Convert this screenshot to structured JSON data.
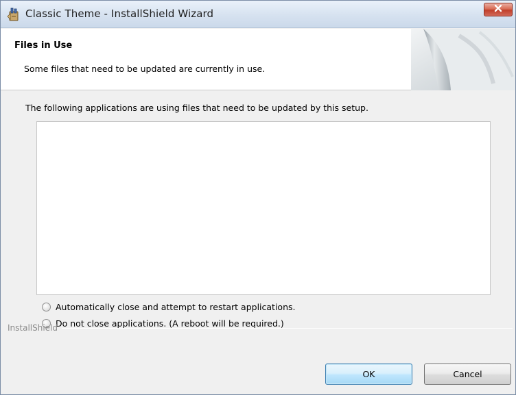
{
  "window": {
    "title": "Classic Theme - InstallShield Wizard",
    "close_label": "✕"
  },
  "banner": {
    "title": "Files in Use",
    "subtitle": "Some files that need to be updated are currently in use."
  },
  "content": {
    "intro": "The following applications are using files that need to be updated by this setup.",
    "applications": [],
    "options": [
      {
        "label": "Automatically close and attempt to restart applications.",
        "selected": false
      },
      {
        "label": "Do not close applications. (A reboot will be required.)",
        "selected": false
      }
    ]
  },
  "footer": {
    "brand": "InstallShield",
    "ok_label": "OK",
    "cancel_label": "Cancel"
  },
  "colors": {
    "close_button": "#c0402a",
    "default_button_border": "#3c7fb1"
  },
  "icons": {
    "app": "installshield-app-icon",
    "close": "close-icon",
    "banner": "page-curl-banner-art"
  }
}
